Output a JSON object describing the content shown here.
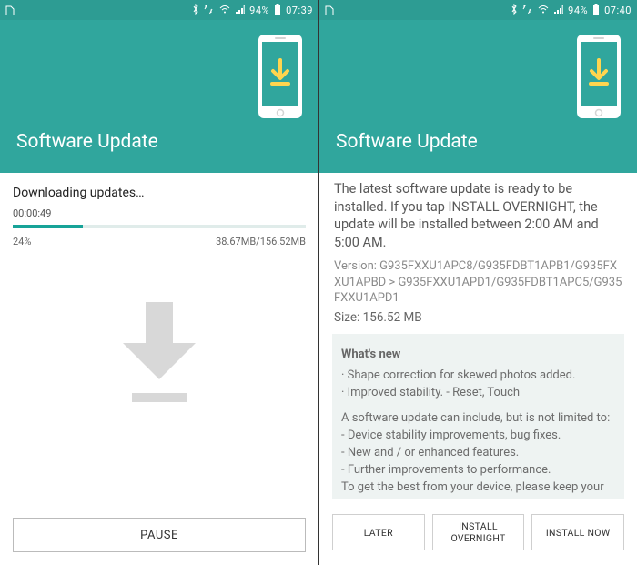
{
  "status": {
    "battery": "94%",
    "left_time": "07:39",
    "right_time": "07:40"
  },
  "header": {
    "title": "Software Update"
  },
  "download": {
    "status": "Downloading updates…",
    "elapsed": "00:00:49",
    "percent": "24%",
    "progress_width": "24%",
    "bytes": "38.67MB/156.52MB",
    "pause": "PAUSE"
  },
  "install": {
    "intro": "The latest software update is ready to be installed. If you tap INSTALL OVERNIGHT, the update will be installed between 2:00 AM and 5:00 AM.",
    "version": "Version: G935FXXU1APC8/G935FDBT1APB1/G935FXXU1APBD > G935FXXU1APD1/G935FDBT1APC5/G935FXXU1APD1",
    "size": "Size: 156.52 MB",
    "whatsnew_title": "What's new",
    "wn1": "· Shape correction for skewed photos added.",
    "wn2": "· Improved stability. - Reset, Touch",
    "wn_para1": "A software update can include, but is not limited to:",
    "wn_li1": " - Device stability improvements, bug fixes.",
    "wn_li2": " - New and / or enhanced features.",
    "wn_li3": " - Further improvements to performance.",
    "wn_para2": "To get the best from your device, please keep your phone up to date and regularly check for software updates.",
    "btn_later": "LATER",
    "btn_overnight": "INSTALL OVERNIGHT",
    "btn_now": "INSTALL NOW"
  }
}
